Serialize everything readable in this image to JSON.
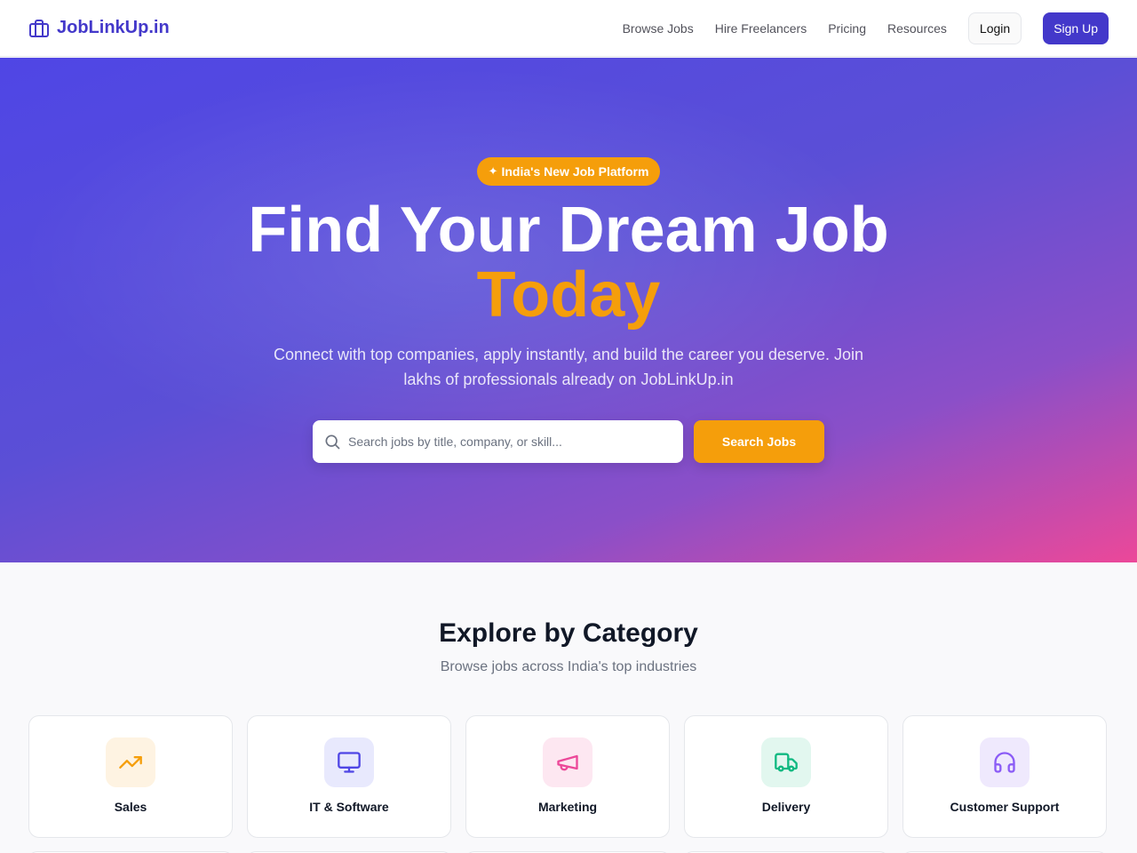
{
  "nav": {
    "brand": "JobLinkUp.in",
    "links": [
      "Browse Jobs",
      "Hire Freelancers",
      "Pricing",
      "Resources"
    ],
    "login": "Login",
    "signup": "Sign Up"
  },
  "hero": {
    "badge": "India's New Job Platform",
    "title_line1": "Find Your Dream Job",
    "title_line2": "Today",
    "subtitle": "Connect with top companies, apply instantly, and build the career you deserve. Join lakhs of professionals already on JobLinkUp.in",
    "search_placeholder": "Search jobs by title, company, or skill...",
    "search_button": "Search Jobs"
  },
  "categories": {
    "title": "Explore by Category",
    "subtitle": "Browse jobs across India's top industries",
    "items": [
      {
        "label": "Sales",
        "icon": "trending-up-icon",
        "color": "#f59e0b",
        "bg": "#fef3e2"
      },
      {
        "label": "IT & Software",
        "icon": "monitor-icon",
        "color": "#4f46e5",
        "bg": "#e8e9fd"
      },
      {
        "label": "Marketing",
        "icon": "megaphone-icon",
        "color": "#ec4899",
        "bg": "#fde7f1"
      },
      {
        "label": "Delivery",
        "icon": "truck-icon",
        "color": "#10b981",
        "bg": "#e2f7ef"
      },
      {
        "label": "Customer Support",
        "icon": "headphones-icon",
        "color": "#8b5cf6",
        "bg": "#efe9fd"
      }
    ]
  },
  "colors": {
    "brand": "#4338ca",
    "accent": "#f59e0b"
  }
}
